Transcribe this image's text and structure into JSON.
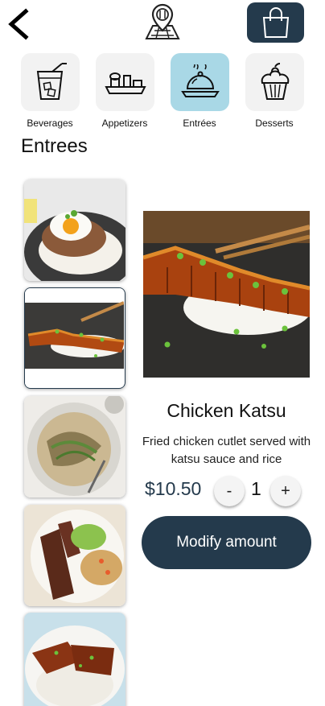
{
  "header": {
    "back_icon": "chevron-left-icon",
    "logo_icon": "map-pin-fork-knife-icon",
    "cart_icon": "shopping-bag-icon"
  },
  "categories": [
    {
      "label": "Beverages",
      "icon": "drink-cup-icon",
      "active": false
    },
    {
      "label": "Appetizers",
      "icon": "appetizer-platter-icon",
      "active": false
    },
    {
      "label": "Entrées",
      "icon": "cloche-icon",
      "active": true
    },
    {
      "label": "Desserts",
      "icon": "cupcake-icon",
      "active": false
    }
  ],
  "section": {
    "title": "Entrees"
  },
  "menu_items": [
    {
      "name": "loco-moco",
      "selected": false
    },
    {
      "name": "chicken-katsu",
      "selected": true
    },
    {
      "name": "noodle-salad",
      "selected": false
    },
    {
      "name": "kalbi-ribs",
      "selected": false
    },
    {
      "name": "huli-huli-chicken",
      "selected": false
    }
  ],
  "detail": {
    "name": "Chicken Katsu",
    "description": "Fried chicken cutlet served with katsu sauce and rice",
    "price": "$10.50",
    "decrement_label": "-",
    "quantity": "1",
    "increment_label": "+",
    "action_label": "Modify amount"
  },
  "colors": {
    "primary": "#243a4c",
    "active_category": "#a9d8e6",
    "tile_bg": "#f2f2f2"
  }
}
